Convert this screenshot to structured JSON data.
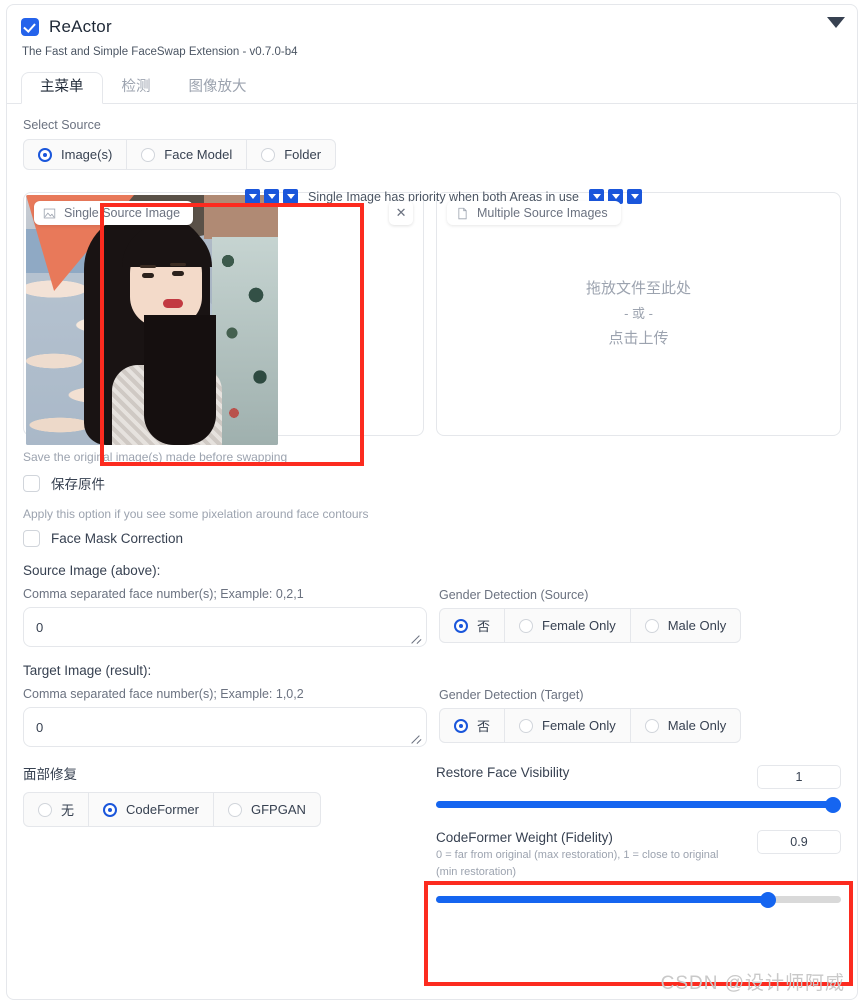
{
  "header": {
    "title": "ReActor",
    "subtitle": "The Fast and Simple FaceSwap Extension - v0.7.0-b4",
    "enabled_checkbox": "enabled",
    "collapse_icon": "chevron-down-icon"
  },
  "tabs": [
    {
      "label": "主菜单",
      "active": true
    },
    {
      "label": "检测",
      "active": false
    },
    {
      "label": "图像放大",
      "active": false
    }
  ],
  "select_source": {
    "label": "Select Source",
    "options": [
      {
        "label": "Image(s)",
        "selected": true
      },
      {
        "label": "Face Model",
        "selected": false
      },
      {
        "label": "Folder",
        "selected": false
      }
    ]
  },
  "priority": {
    "text": "Single Image has priority when both Areas in use",
    "left_arrows": [
      "arrow-down-icon",
      "arrow-down-icon",
      "arrow-down-icon"
    ],
    "right_arrows": [
      "arrow-down-icon",
      "arrow-down-icon",
      "arrow-down-icon"
    ]
  },
  "single_source": {
    "tab_label": "Single Source Image",
    "tab_icon": "image-icon",
    "close_label": "✕"
  },
  "multiple_source": {
    "tab_label": "Multiple Source Images",
    "tab_icon": "file-icon",
    "drop_line1": "拖放文件至此处",
    "drop_line2": "- 或 -",
    "drop_line3": "点击上传"
  },
  "save_original": {
    "hint": "Save the original image(s) made before swapping",
    "label": "保存原件",
    "checked": false
  },
  "face_mask": {
    "hint": "Apply this option if you see some pixelation around face contours",
    "label": "Face Mask Correction",
    "checked": false
  },
  "source_image": {
    "section_title": "Source Image (above):",
    "input_label": "Comma separated face number(s); Example: 0,2,1",
    "input_value": "0",
    "gender_label": "Gender Detection (Source)",
    "gender_options": [
      {
        "label": "否",
        "selected": true
      },
      {
        "label": "Female Only",
        "selected": false
      },
      {
        "label": "Male Only",
        "selected": false
      }
    ]
  },
  "target_image": {
    "section_title": "Target Image (result):",
    "input_label": "Comma separated face number(s); Example: 1,0,2",
    "input_value": "0",
    "gender_label": "Gender Detection (Target)",
    "gender_options": [
      {
        "label": "否",
        "selected": true
      },
      {
        "label": "Female Only",
        "selected": false
      },
      {
        "label": "Male Only",
        "selected": false
      }
    ]
  },
  "face_restore": {
    "label": "面部修复",
    "options": [
      {
        "label": "无",
        "selected": false
      },
      {
        "label": "CodeFormer",
        "selected": true
      },
      {
        "label": "GFPGAN",
        "selected": false
      }
    ]
  },
  "restore_visibility": {
    "title": "Restore Face Visibility",
    "value": "1",
    "percent": 100
  },
  "codeformer_weight": {
    "title": "CodeFormer Weight (Fidelity)",
    "description": "0 = far from original (max restoration), 1 = close to original (min restoration)",
    "value": "0.9",
    "percent": 82
  },
  "watermark": "CSDN @设计师阿威",
  "colors": {
    "accent_blue": "#1a56db",
    "slider_blue": "#1565f0",
    "highlight_red": "#fc2b1f"
  }
}
